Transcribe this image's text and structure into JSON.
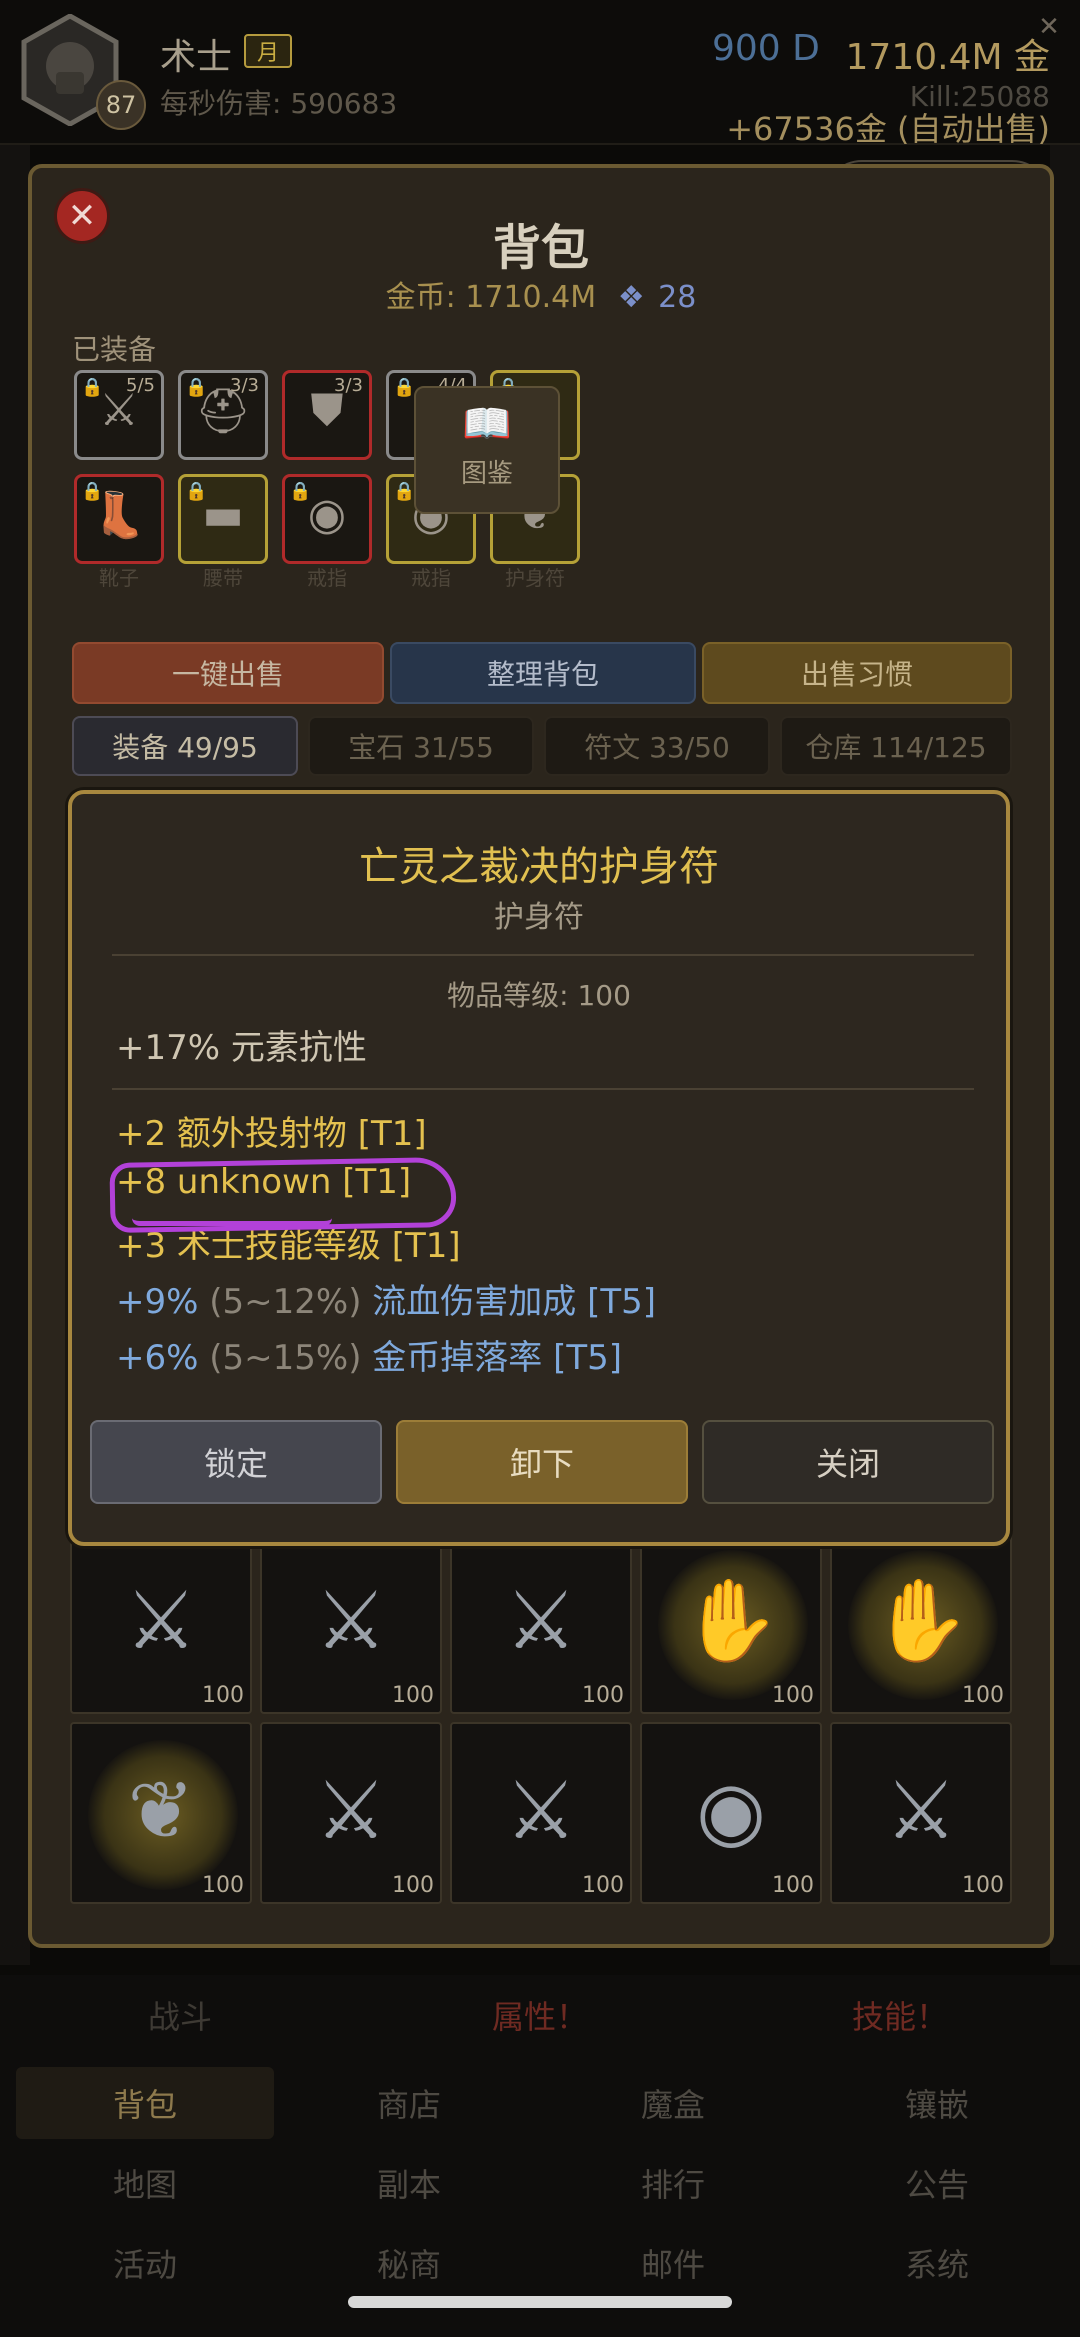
{
  "header": {
    "player_name": "术士",
    "month_tag": "月",
    "level": "87",
    "dps": "每秒伤害: 590683",
    "diamonds": "900 D",
    "gold": "1710.4M 金",
    "kill": "Kill:25088",
    "auto_sell": "+67536金 (自动出售)"
  },
  "panel": {
    "title": "背包",
    "gold": "金币: 1710.4M",
    "gems": "28",
    "equipped_label": "已装备",
    "codex_label": "图鉴",
    "equipped": [
      {
        "icon": "sword-icon",
        "count": "5/5",
        "locked": true,
        "border": "#8a8a8a"
      },
      {
        "icon": "helmet-icon",
        "count": "3/3",
        "locked": true,
        "border": "#8a8a8a"
      },
      {
        "icon": "armor-icon",
        "count": "3/3",
        "locked": false,
        "border": "#b02a2a"
      },
      {
        "icon": "shield-icon",
        "count": "4/4",
        "locked": true,
        "border": "#8a8a8a"
      },
      {
        "icon": "gloves-icon",
        "count": "",
        "locked": true,
        "border": "#b5a137"
      },
      {
        "icon": "boots-icon",
        "count": "",
        "locked": true,
        "border": "#b02a2a",
        "name": "靴子"
      },
      {
        "icon": "belt-icon",
        "count": "",
        "locked": true,
        "border": "#b5a137",
        "name": "腰带"
      },
      {
        "icon": "ring-icon",
        "count": "",
        "locked": true,
        "border": "#b02a2a",
        "name": "戒指"
      },
      {
        "icon": "ring-icon",
        "count": "",
        "locked": true,
        "border": "#b5a137",
        "name": "戒指"
      },
      {
        "icon": "amulet-icon",
        "count": "",
        "locked": false,
        "border": "#b5a137",
        "name": "护身符"
      }
    ],
    "actions": {
      "sell_all": "一键出售",
      "sort": "整理背包",
      "sell_habit": "出售习惯"
    },
    "tabs": [
      "装备 49/95",
      "宝石 31/55",
      "符文 33/50",
      "仓库 114/125"
    ],
    "grid": [
      {
        "icon": "sword-icon",
        "ilvl": "100",
        "glow": false
      },
      {
        "icon": "sword-icon",
        "ilvl": "100",
        "glow": false
      },
      {
        "icon": "sword-icon",
        "ilvl": "100",
        "glow": false
      },
      {
        "icon": "gloves-icon",
        "ilvl": "100",
        "glow": true
      },
      {
        "icon": "gloves-icon",
        "ilvl": "100",
        "glow": true
      },
      {
        "icon": "amulet-icon",
        "ilvl": "100",
        "glow": true
      },
      {
        "icon": "sword-icon",
        "ilvl": "100",
        "glow": false
      },
      {
        "icon": "sword-icon",
        "ilvl": "100",
        "glow": false
      },
      {
        "icon": "ring-icon",
        "ilvl": "100",
        "glow": false
      },
      {
        "icon": "sword-icon",
        "ilvl": "100",
        "glow": false
      }
    ]
  },
  "capsule": {
    "more_icon": "more-icon",
    "target_icon": "target-icon"
  },
  "tooltip": {
    "name": "亡灵之裁决的护身符",
    "type": "护身符",
    "item_level": "物品等级: 100",
    "implicit": "+17% 元素抗性",
    "affixes": [
      {
        "text": "+2 额外投射物 [T1]",
        "color": "gold"
      },
      {
        "text": "+8 unknown [T1]",
        "color": "gold",
        "annotated": true
      },
      {
        "text": "+3 术士技能等级 [T1]",
        "color": "gold"
      },
      {
        "value": "+9%",
        "range": "(5~12%)",
        "rest": "流血伤害加成 [T5]",
        "color": "blue"
      },
      {
        "value": "+6%",
        "range": "(5~15%)",
        "rest": "金币掉落率 [T5]",
        "color": "blue"
      }
    ],
    "buttons": {
      "lock": "锁定",
      "unequip": "卸下",
      "close": "关闭"
    }
  },
  "bottom_nav": {
    "subtabs": [
      {
        "label": "战斗",
        "color": "#3e3a34"
      },
      {
        "label": "属性！",
        "color": "#6f2a22"
      },
      {
        "label": "技能！",
        "color": "#6f2a22"
      }
    ],
    "rows": [
      [
        "背包",
        "商店",
        "魔盒",
        "镶嵌"
      ],
      [
        "地图",
        "副本",
        "排行",
        "公告"
      ],
      [
        "活动",
        "秘商",
        "邮件",
        "系统"
      ]
    ]
  }
}
